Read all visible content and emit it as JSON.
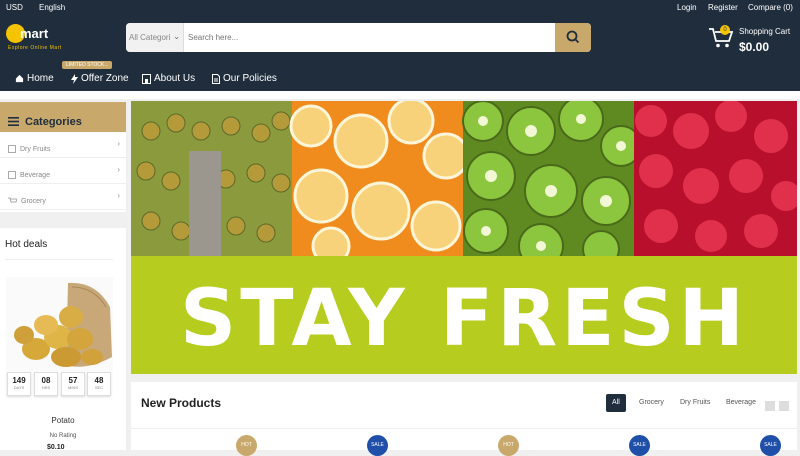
{
  "topbar": {
    "currency": "USD",
    "language": "English",
    "login": "Login",
    "register": "Register",
    "compare": "Compare (0)"
  },
  "logo": {
    "word": "mart",
    "tagline": "Explore Online Mart"
  },
  "search": {
    "category_placeholder": "All Categori",
    "placeholder": "Search here..."
  },
  "cart": {
    "label": "Shopping Cart",
    "amount": "$0.00",
    "count": "0"
  },
  "nav": {
    "items": [
      {
        "label": "Home",
        "icon": "home-icon"
      },
      {
        "label": "Offer Zone",
        "icon": "bolt-icon"
      },
      {
        "label": "About Us",
        "icon": "building-icon"
      },
      {
        "label": "Our Policies",
        "icon": "document-icon"
      }
    ],
    "limited_badge": "LIMITED STOCK..."
  },
  "categories": {
    "title": "Categories",
    "items": [
      {
        "label": "Dry Fruits"
      },
      {
        "label": "Beverage"
      },
      {
        "label": "Grocery"
      }
    ]
  },
  "hot_deals": {
    "title": "Hot deals",
    "timer": [
      {
        "value": "149",
        "unit": "DAYS"
      },
      {
        "value": "08",
        "unit": "HRS"
      },
      {
        "value": "57",
        "unit": "MINS"
      },
      {
        "value": "48",
        "unit": "SEC"
      }
    ],
    "product_name": "Potato",
    "rating": "No Rating",
    "price": "$0.10"
  },
  "banner": {
    "text": "STAY FRESH"
  },
  "new_products": {
    "title": "New Products",
    "tabs": [
      "All",
      "Grocery",
      "Dry Fruits",
      "Beverage"
    ],
    "badges": [
      "HOT",
      "SALE",
      "HOT",
      "SALE",
      "SALE"
    ]
  },
  "colors": {
    "navy": "#1f2d3d",
    "gold": "#c9a86b",
    "yellow": "#f5c400",
    "lime": "#b6cc1e",
    "sale_blue": "#1f4fa8"
  }
}
